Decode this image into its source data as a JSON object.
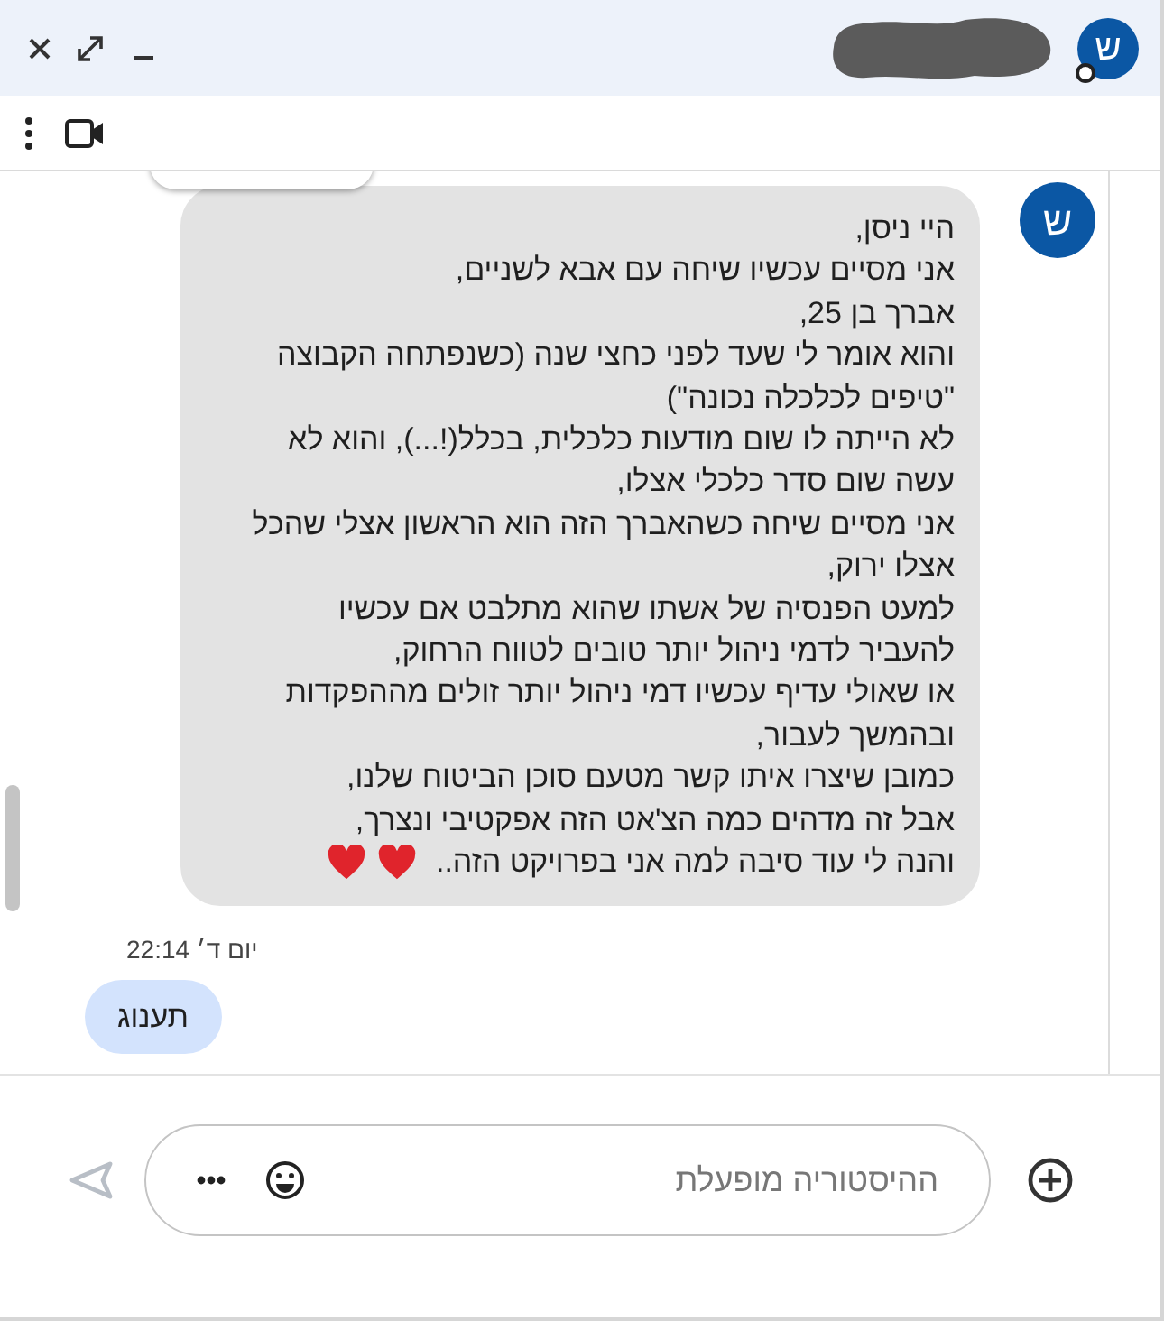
{
  "header": {
    "avatar_letter": "ש"
  },
  "messages": [
    {
      "kind": "incoming",
      "avatar_letter": "ש",
      "text": "היי ניסן,\nאני מסיים עכשיו שיחה עם אבא לשניים,\nאברך בן 25,\nוהוא אומר לי שעד לפני כחצי שנה (כשנפתחה הקבוצה \"טיפים לכלכלה נכונה\")\nלא הייתה לו שום מודעות כלכלית, בכלל(!...), והוא לא עשה שום סדר כלכלי אצלו,\nאני מסיים שיחה כשהאברך הזה הוא הראשון אצלי שהכל אצלו ירוק,\nלמעט הפנסיה של אשתו שהוא מתלבט אם עכשיו להעביר לדמי ניהול יותר טובים לטווח הרחוק,\nאו שאולי עדיף עכשיו דמי ניהול יותר זולים מההפקדות ובהמשך לעבור,\nכמובן שיצרו איתו קשר מטעם סוכן הביטוח שלנו,\nאבל זה מדהים כמה הצ'אט הזה אפקטיבי ונצרך,",
      "closing": "והנה לי עוד סיבה למה אני בפרויקט הזה..",
      "reactions": [
        {
          "kind": "heart"
        },
        {
          "kind": "heart"
        }
      ]
    },
    {
      "kind": "outgoing",
      "time": "יום ד׳ 22:14",
      "text": "תענוג"
    }
  ],
  "composer": {
    "placeholder": "ההיסטוריה מופעלת"
  }
}
